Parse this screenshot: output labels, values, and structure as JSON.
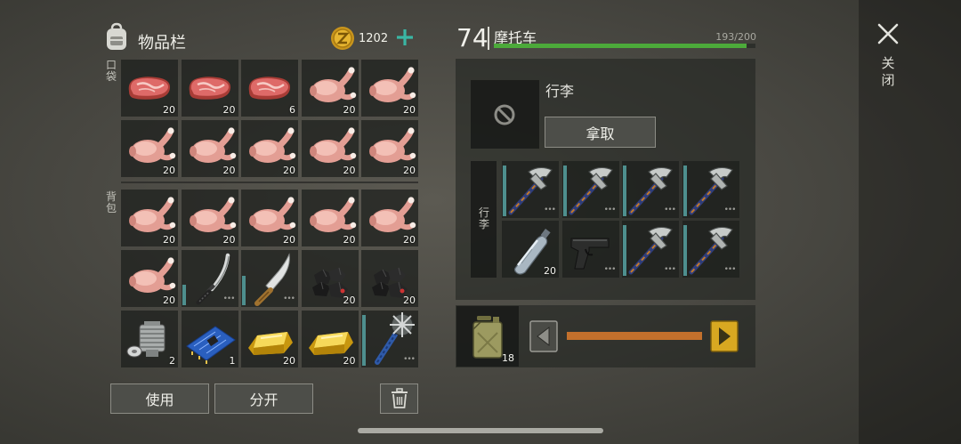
{
  "side": {
    "close_label": "关闭"
  },
  "inventory": {
    "title": "物品栏",
    "coins": "1202",
    "pocket_label": "口袋",
    "backpack_label": "背包",
    "use_label": "使用",
    "split_label": "分开"
  },
  "pocket": [
    {
      "icon": "steak-icon",
      "count": "20"
    },
    {
      "icon": "steak-icon",
      "count": "20"
    },
    {
      "icon": "steak-icon",
      "count": "6"
    },
    {
      "icon": "raw-chicken-icon",
      "count": "20"
    },
    {
      "icon": "raw-chicken-icon",
      "count": "20"
    },
    {
      "icon": "raw-chicken-icon",
      "count": "20"
    },
    {
      "icon": "raw-chicken-icon",
      "count": "20"
    },
    {
      "icon": "raw-chicken-icon",
      "count": "20"
    },
    {
      "icon": "raw-chicken-icon",
      "count": "20"
    },
    {
      "icon": "raw-chicken-icon",
      "count": "20"
    }
  ],
  "backpack": [
    {
      "icon": "raw-chicken-icon",
      "count": "20"
    },
    {
      "icon": "raw-chicken-icon",
      "count": "20"
    },
    {
      "icon": "raw-chicken-icon",
      "count": "20"
    },
    {
      "icon": "raw-chicken-icon",
      "count": "20"
    },
    {
      "icon": "raw-chicken-icon",
      "count": "20"
    },
    {
      "icon": "raw-chicken-icon",
      "count": "20"
    },
    {
      "icon": "katana-icon",
      "count": "",
      "durability": 0.38
    },
    {
      "icon": "machete-icon",
      "count": "",
      "durability": 0.55
    },
    {
      "icon": "coal-icon",
      "count": "20"
    },
    {
      "icon": "coal-icon",
      "count": "20"
    },
    {
      "icon": "engine-part-icon",
      "count": "2"
    },
    {
      "icon": "circuit-board-icon",
      "count": "1"
    },
    {
      "icon": "gold-bar-icon",
      "count": "20"
    },
    {
      "icon": "gold-bar-icon",
      "count": "20"
    },
    {
      "icon": "spiked-club-icon",
      "count": "",
      "durability": 0.95
    }
  ],
  "vehicle": {
    "level": "74",
    "name": "摩托车",
    "capacity": "193/200",
    "fill_ratio": 0.965,
    "luggage_title": "行李",
    "take_label": "拿取",
    "luggage_vlabel": "行李",
    "luggage_items": [
      {
        "icon": "pickaxe-icon",
        "count": "",
        "durability": 0.95
      },
      {
        "icon": "pickaxe-icon",
        "count": "",
        "durability": 0.95
      },
      {
        "icon": "pickaxe-icon",
        "count": "",
        "durability": 0.95
      },
      {
        "icon": "pickaxe-icon",
        "count": "",
        "durability": 0.95
      },
      {
        "icon": "water-bottle-icon",
        "count": "20"
      },
      {
        "icon": "pistol-icon",
        "count": ""
      },
      {
        "icon": "pickaxe-icon",
        "count": "",
        "durability": 0.95
      },
      {
        "icon": "pickaxe-icon",
        "count": "",
        "durability": 0.95
      }
    ],
    "fuel_count": "18",
    "fuel_ratio": 1.0
  },
  "colors": {
    "accent_teal": "#3ab6a4",
    "hp_green": "#4caa3a",
    "fuel_orange": "#c3702c",
    "arrow_gold": "#d8a821"
  }
}
